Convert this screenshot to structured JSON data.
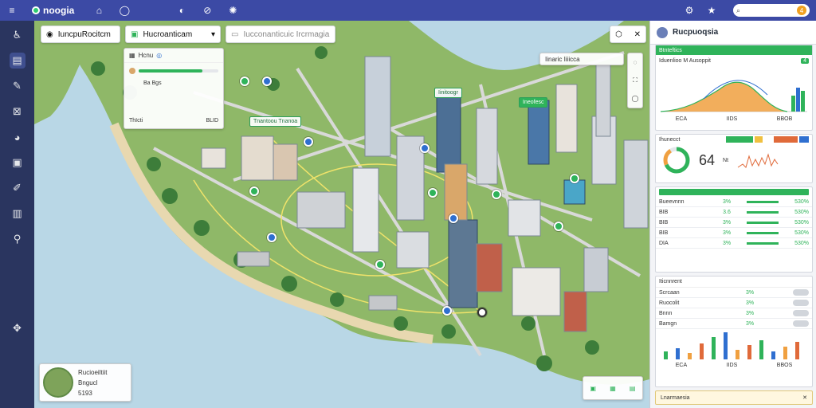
{
  "topbar": {
    "brand": "noogia",
    "search_placeholder": "",
    "notification_count": "4"
  },
  "map": {
    "search_pill_1": "IuncpuRocitcm",
    "search_pill_2": "Hucroanticam",
    "search_pill_3": "Iucconanticuic Ircrmagia",
    "info_card": {
      "title": "Hcnu",
      "row2": "Ba Bgs",
      "footer_left": "ThIcti",
      "footer_right": "BLID"
    },
    "label_top_right": "Iinaric  Iiiicca",
    "map_label_1": "Tnantoou   Tnanoa",
    "map_label_2": "Iinitoogr",
    "map_label_3": "Ineofesc",
    "profile": {
      "name": "Rucioeiltiit",
      "sub": "Bngucl",
      "code": "5193"
    }
  },
  "rpanel": {
    "title": "Rucpuoqsia",
    "card1": {
      "header": "Btnteftics",
      "subtitle": "Iduenlioo M Ausoppit",
      "x1": "ECA",
      "x2": "IIDS",
      "x3": "BBOB",
      "badge": "4"
    },
    "card2": {
      "title": "Ihunecct",
      "value": "64",
      "unit": "Nt"
    },
    "table1": {
      "rows": [
        {
          "label": "Bueevnnn",
          "v1": "3%",
          "v2": "530%"
        },
        {
          "label": "BIB",
          "v1": "3.6",
          "v2": "530%"
        },
        {
          "label": "BIB",
          "v1": "3%",
          "v2": "530%"
        },
        {
          "label": "BIB",
          "v1": "3%",
          "v2": "530%"
        },
        {
          "label": "DIA",
          "v1": "3%",
          "v2": "530%"
        }
      ]
    },
    "table2": {
      "title": "Iticnnrent",
      "rows": [
        {
          "label": "Scrcaan",
          "v1": "3%"
        },
        {
          "label": "Ruocolit",
          "v1": "3%"
        },
        {
          "label": "Bnnn",
          "v1": "3%"
        },
        {
          "label": "Bamgn",
          "v1": "3%"
        }
      ],
      "x1": "ECA",
      "x2": "IIDS",
      "x3": "BBOS"
    },
    "footer": "Lnarmaesia"
  },
  "colors": {
    "topbar": "#3c4aa5",
    "rail": "#2a355f",
    "accent_green": "#2fb35a",
    "water": "#b9d7e6"
  }
}
